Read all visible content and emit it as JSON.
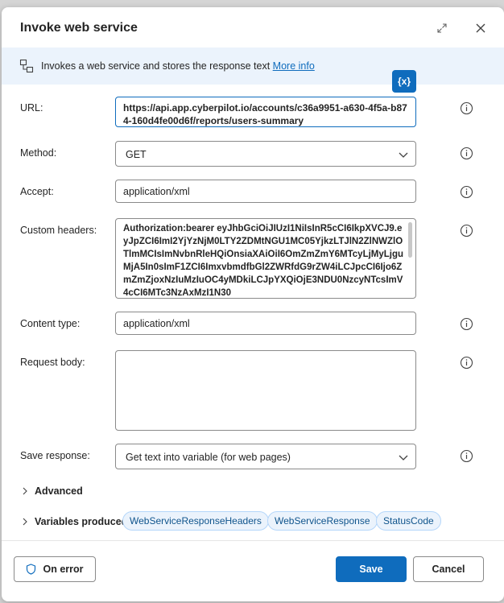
{
  "dialog": {
    "title": "Invoke web service",
    "info_text": "Invokes a web service and stores the response text",
    "info_link": "More info",
    "variable_button": "{x}"
  },
  "fields": {
    "url": {
      "label": "URL:",
      "value": "https://api.app.cyberpilot.io/accounts/c36a9951-a630-4f5a-b874-160d4fe00d6f/reports/users-summary"
    },
    "method": {
      "label": "Method:",
      "value": "GET"
    },
    "accept": {
      "label": "Accept:",
      "value": "application/xml"
    },
    "custom_headers": {
      "label": "Custom headers:",
      "value": "Authorization:bearer eyJhbGciOiJIUzI1NiIsInR5cCI6IkpXVCJ9.eyJpZCI6ImI2YjYzNjM0LTY2ZDMtNGU1MC05YjkzLTJlN2ZlNWZlOTlmMCIsImNvbnRleHQiOnsiaXAiOiI6OmZmZmY6MTcyLjMyLjguMjA5In0sImF1ZCI6ImxvbmdfbGl2ZWRfdG9rZW4iLCJpcCI6Ijo6ZmZmZjoxNzIuMzIuOC4yMDkiLCJpYXQiOjE3NDU0NzcyNTcsImV4cCI6MTc3NzAxMzI1N30"
    },
    "content_type": {
      "label": "Content type:",
      "value": "application/xml"
    },
    "request_body": {
      "label": "Request body:",
      "value": ""
    },
    "save_response": {
      "label": "Save response:",
      "value": "Get text into variable (for web pages)"
    }
  },
  "advanced": {
    "label": "Advanced"
  },
  "variables_produced": {
    "label": "Variables produced",
    "items": [
      "WebServiceResponseHeaders",
      "WebServiceResponse",
      "StatusCode"
    ]
  },
  "footer": {
    "on_error": "On error",
    "save": "Save",
    "cancel": "Cancel"
  },
  "colors": {
    "accent": "#0f6cbd",
    "info_bar_bg": "#ebf3fc",
    "chip_bg": "#ebf3fc"
  }
}
